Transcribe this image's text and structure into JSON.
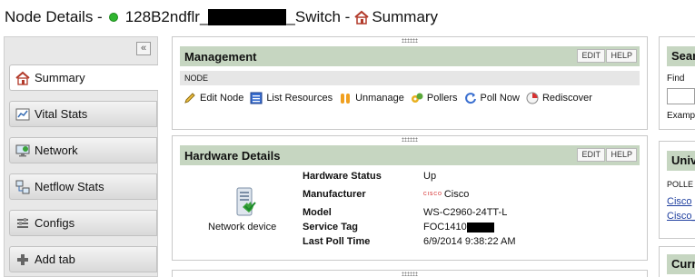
{
  "page": {
    "title_prefix": "Node Details -",
    "node_name_start": "128B2ndflr_",
    "node_name_end": "_Switch -",
    "view_name": "Summary",
    "status_color": "#2fb52f"
  },
  "sidebar": {
    "collapse_glyph": "«",
    "tabs": [
      {
        "label": "Summary",
        "icon": "home-icon"
      },
      {
        "label": "Vital Stats",
        "icon": "chart-icon"
      },
      {
        "label": "Network",
        "icon": "monitor-icon"
      },
      {
        "label": "Netflow Stats",
        "icon": "netflow-icon"
      },
      {
        "label": "Configs",
        "icon": "wrench-icon"
      },
      {
        "label": "Add tab",
        "icon": "plus-icon"
      }
    ]
  },
  "management": {
    "title": "Management",
    "edit": "EDIT",
    "help": "HELP",
    "subheader": "NODE",
    "actions": [
      {
        "label": "Edit Node",
        "icon": "pencil-icon"
      },
      {
        "label": "List Resources",
        "icon": "list-icon"
      },
      {
        "label": "Unmanage",
        "icon": "pause-icon"
      },
      {
        "label": "Pollers",
        "icon": "pollers-icon"
      },
      {
        "label": "Poll Now",
        "icon": "refresh-icon"
      },
      {
        "label": "Rediscover",
        "icon": "rediscover-icon"
      }
    ]
  },
  "hardware": {
    "title": "Hardware Details",
    "edit": "EDIT",
    "help": "HELP",
    "device_label": "Network device",
    "rows": [
      {
        "key": "Hardware Status",
        "value": "Up"
      },
      {
        "key": "Manufacturer",
        "value": "Cisco",
        "logo": "CISCO"
      },
      {
        "key": "Model",
        "value": "WS-C2960-24TT-L"
      },
      {
        "key": "Service Tag",
        "value": "FOC1410"
      },
      {
        "key": "Last Poll Time",
        "value": "6/9/2014 9:38:22 AM"
      }
    ]
  },
  "right": {
    "search_title": "Sear",
    "find_label": "Find",
    "example_label": "Examp",
    "univ_title": "Univ",
    "poller_label": "POLLE",
    "links": [
      "Cisco",
      "Cisco_"
    ],
    "curr_title": "Curr"
  }
}
